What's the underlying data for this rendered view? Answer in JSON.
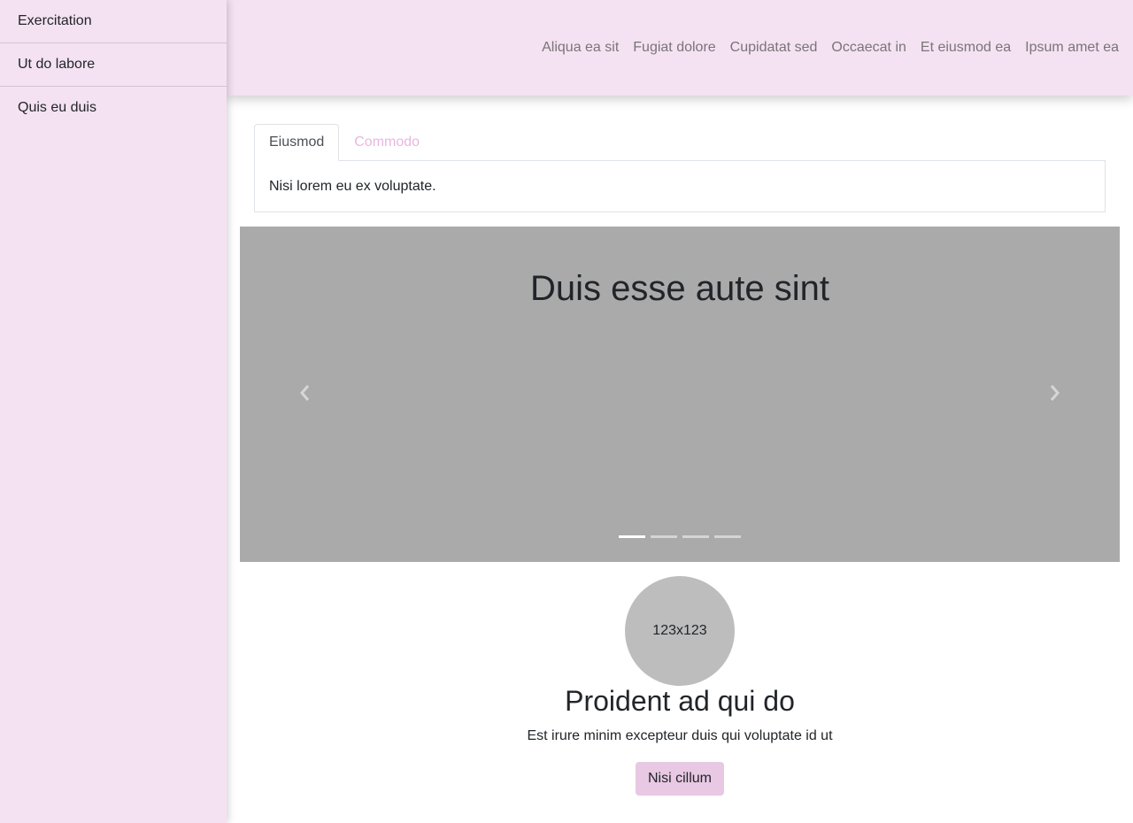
{
  "sidebar": {
    "items": [
      {
        "label": "Exercitation"
      },
      {
        "label": "Ut do labore"
      },
      {
        "label": "Quis eu duis"
      }
    ]
  },
  "navbar": {
    "links": [
      {
        "label": "Aliqua ea sit"
      },
      {
        "label": "Fugiat dolore"
      },
      {
        "label": "Cupidatat sed"
      },
      {
        "label": "Occaecat in"
      },
      {
        "label": "Et eiusmod ea"
      },
      {
        "label": "Ipsum amet ea"
      }
    ]
  },
  "tabs": {
    "items": [
      {
        "label": "Eiusmod",
        "active": true
      },
      {
        "label": "Commodo",
        "active": false
      }
    ],
    "panel_text": "Nisi lorem eu ex voluptate."
  },
  "carousel": {
    "heading": "Duis esse aute sint",
    "prev_icon": "chevron-left-icon",
    "next_icon": "chevron-right-icon",
    "slide_count": 4,
    "active_slide": 1,
    "background": "#aaaaaa"
  },
  "feature": {
    "avatar_text": "123x123",
    "title": "Proident ad qui do",
    "text": "Est irure minim excepteur duis qui voluptate id ut",
    "button_label": "Nisi cillum"
  },
  "colors": {
    "sidebar_bg": "#f4e2f2",
    "navbar_bg": "#f4e2f2",
    "accent": "#e8b7e0",
    "button_bg": "#e8c8e3"
  }
}
